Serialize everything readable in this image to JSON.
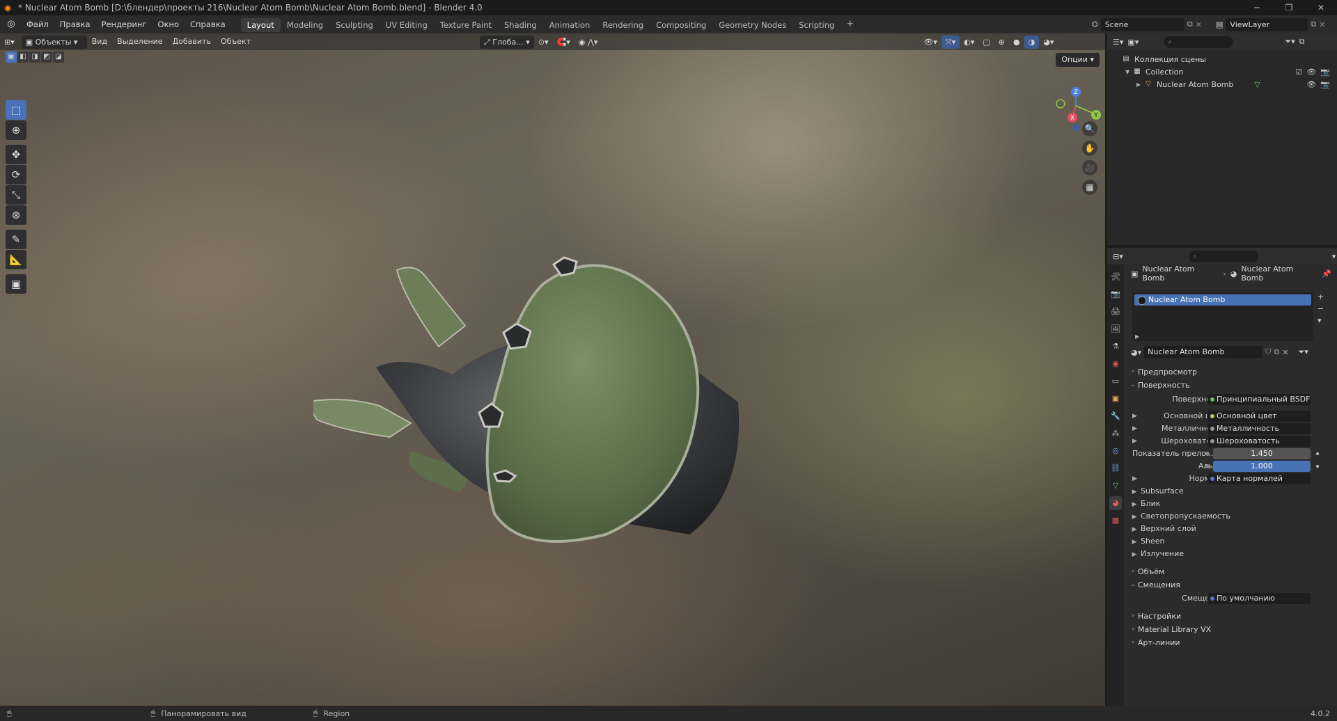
{
  "window": {
    "title": "* Nuclear Atom Bomb [D:\\блендер\\проекты 216\\Nuclear Atom Bomb\\Nuclear Atom Bomb.blend] - Blender 4.0"
  },
  "menu": [
    "Файл",
    "Правка",
    "Рендеринг",
    "Окно",
    "Справка"
  ],
  "workspaces": [
    "Layout",
    "Modeling",
    "Sculpting",
    "UV Editing",
    "Texture Paint",
    "Shading",
    "Animation",
    "Rendering",
    "Compositing",
    "Geometry Nodes",
    "Scripting"
  ],
  "active_workspace": "Layout",
  "scene": {
    "name": "Scene",
    "view_layer": "ViewLayer"
  },
  "viewport": {
    "mode": "Объекты",
    "menus": [
      "Вид",
      "Выделение",
      "Добавить",
      "Объект"
    ],
    "orientation": "Глоба...",
    "options": "Опции",
    "gizmo": {
      "x": "X",
      "y": "Y",
      "z": "Z"
    }
  },
  "outliner": {
    "scene_collection": "Коллекция сцены",
    "collection": "Collection",
    "object": "Nuclear Atom Bomb"
  },
  "properties": {
    "breadcrumb_object": "Nuclear Atom Bomb",
    "breadcrumb_material": "Nuclear Atom Bomb",
    "slot": "Nuclear Atom Bomb",
    "material_name": "Nuclear Atom Bomb",
    "sections": {
      "preview": "Предпросмотр",
      "surface": "Поверхность",
      "volume": "Объём",
      "displacement": "Смещения",
      "settings": "Настройки",
      "matlib": "Material Library VX",
      "lineart": "Арт-линии"
    },
    "surface_rows": {
      "surface_label": "Поверхность",
      "surface_value": "Принципиальный BSDF",
      "base_label": "Основной цвет",
      "base_value": "Основной цвет",
      "metal_label": "Металличность",
      "metal_value": "Металличность",
      "rough_label": "Шероховатость",
      "rough_value": "Шероховатость",
      "ior_label": "Показатель прело...",
      "ior_value": "1.450",
      "alpha_label": "Альфа",
      "alpha_value": "1.000",
      "normal_label": "Нормаль",
      "normal_value": "Карта нормалей"
    },
    "subpanels": [
      "Subsurface",
      "Блик",
      "Светопропускаемость",
      "Верхний слой",
      "Sheen",
      "Излучение"
    ],
    "displacement_rows": {
      "label": "Смещения",
      "value": "По умолчанию"
    }
  },
  "status": {
    "pan": "Панорамировать вид",
    "region": "Region",
    "version": "4.0.2"
  }
}
